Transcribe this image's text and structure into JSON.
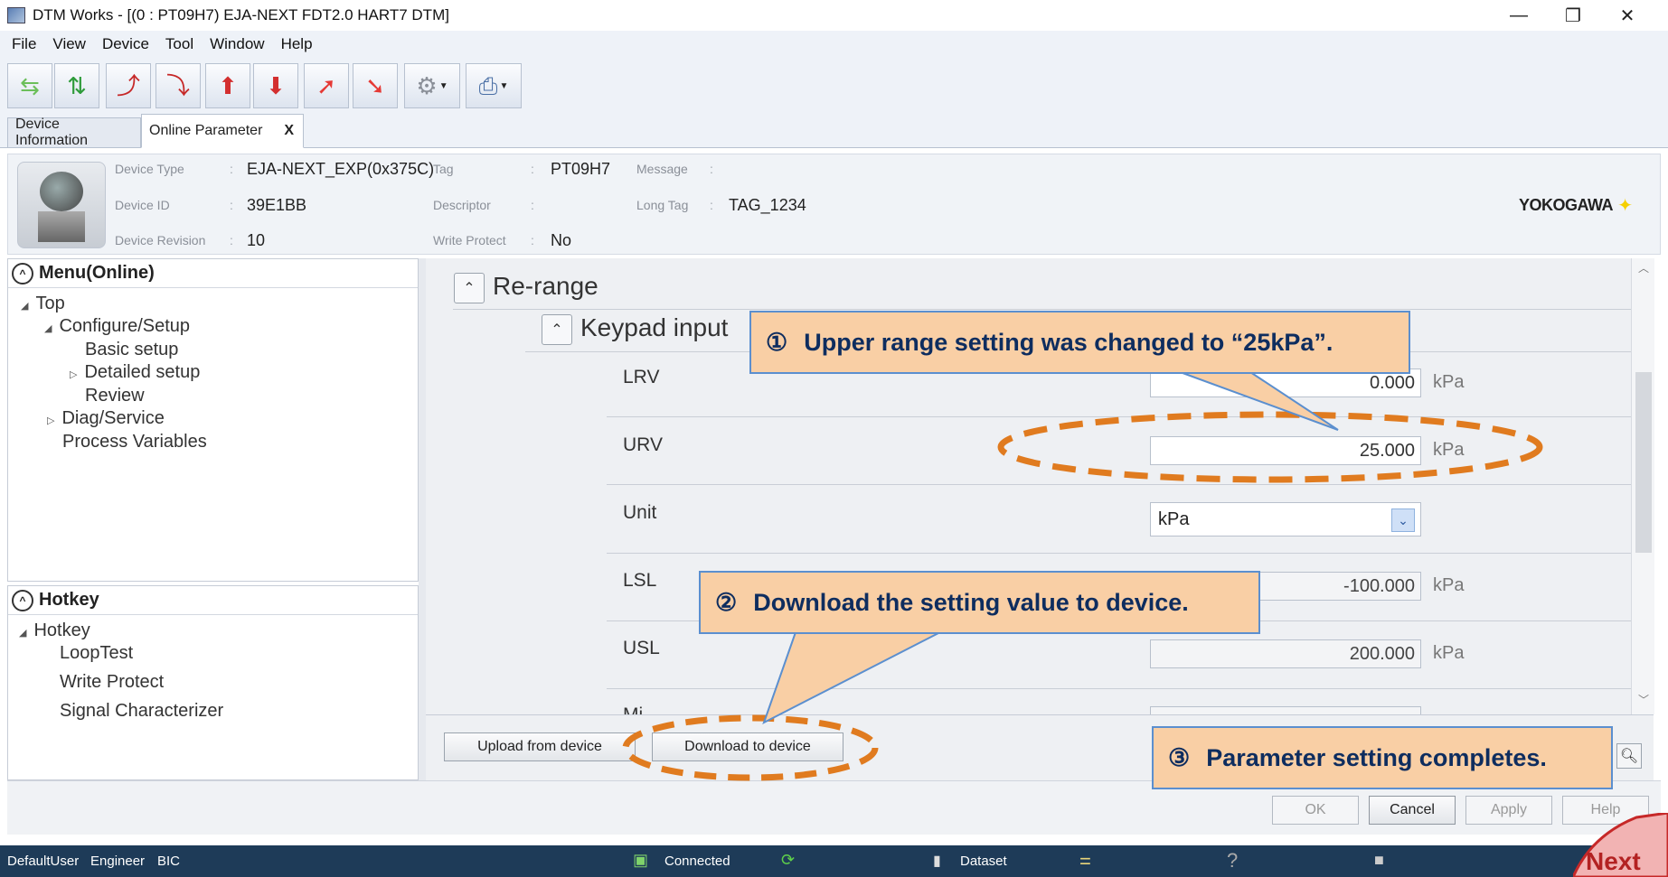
{
  "window": {
    "title": "DTM Works - [(0 : PT09H7) EJA-NEXT FDT2.0 HART7 DTM]",
    "minimize": "—",
    "restore": "❐",
    "close": "✕"
  },
  "menu": [
    "File",
    "View",
    "Device",
    "Tool",
    "Window",
    "Help"
  ],
  "toolbar": {
    "buttons": [
      {
        "name": "disconnect-icon",
        "glyph": "⇆",
        "color": "#6bbf5a"
      },
      {
        "name": "connect-icon",
        "glyph": "⇅",
        "color": "#2e9b3a"
      },
      {
        "name": "upload-device-icon",
        "glyph": "⤴",
        "color": "#c62828"
      },
      {
        "name": "download-device-icon",
        "glyph": "⤵",
        "color": "#c62828"
      },
      {
        "name": "upload-disk-icon",
        "glyph": "⬆",
        "color": "#d32f2f"
      },
      {
        "name": "download-disk-icon",
        "glyph": "⬇",
        "color": "#d32f2f"
      },
      {
        "name": "export-icon",
        "glyph": "➚",
        "color": "#e53935"
      },
      {
        "name": "import-icon",
        "glyph": "➘",
        "color": "#e53935"
      },
      {
        "name": "settings-tool-icon",
        "glyph": "⚙",
        "color": "#8a8f98",
        "dropdown": true
      },
      {
        "name": "print-icon",
        "glyph": "⎙",
        "color": "#4a6fa5",
        "dropdown": true
      }
    ]
  },
  "tabs": {
    "device_information": "Device Information",
    "online_parameter": "Online Parameter",
    "close": "X"
  },
  "device": {
    "type_label": "Device Type",
    "type_value": "EJA-NEXT_EXP(0x375C)",
    "id_label": "Device ID",
    "id_value": "39E1BB",
    "revision_label": "Device Revision",
    "revision_value": "10",
    "tag_label": "Tag",
    "tag_value": "PT09H7",
    "descriptor_label": "Descriptor",
    "descriptor_value": "",
    "write_protect_label": "Write Protect",
    "write_protect_value": "No",
    "message_label": "Message",
    "message_value": "",
    "long_tag_label": "Long Tag",
    "long_tag_value": "TAG_1234",
    "separator": ":",
    "logo": "YOKOGAWA"
  },
  "menu_panel": {
    "title": "Menu(Online)",
    "items": {
      "top": "Top",
      "configure": "Configure/Setup",
      "basic": "Basic setup",
      "detailed": "Detailed setup",
      "review": "Review",
      "diag": "Diag/Service",
      "process": "Process Variables"
    }
  },
  "hotkey_panel": {
    "title": "Hotkey",
    "items": {
      "root": "Hotkey",
      "loop": "LoopTest",
      "write_protect": "Write Protect",
      "signal": "Signal Characterizer"
    }
  },
  "params": {
    "rerange": "Re-range",
    "keypad": "Keypad input",
    "lrv_label": "LRV",
    "lrv_value": "0.000",
    "urv_label": "URV",
    "urv_value": "25.000",
    "unit_label": "Unit",
    "unit_value": "kPa",
    "lsl_label": "LSL",
    "lsl_value": "-100.000",
    "usl_label": "USL",
    "usl_value": "200.000",
    "unit": "kPa",
    "partial_label": "Mi"
  },
  "buttons": {
    "upload": "Upload from device",
    "download": "Download to device",
    "ok": "OK",
    "cancel": "Cancel",
    "apply": "Apply",
    "help": "Help"
  },
  "status": {
    "user": "DefaultUser",
    "role": "Engineer",
    "bic": "BIC",
    "connected": "Connected",
    "dataset": "Dataset",
    "compare": "=",
    "unknown": "?"
  },
  "callouts": {
    "c1_num": "①",
    "c1_text": "Upper range setting  was changed to “25kPa”.",
    "c2_num": "②",
    "c2_text": "Download the setting value to device.",
    "c3_num": "③",
    "c3_text": "Parameter setting  completes."
  },
  "next": "Next",
  "colors": {
    "callout_bg": "#f9cfa5",
    "callout_border": "#5b8fcf",
    "highlight_ellipse": "#e07b1f",
    "statusbar": "#1e3b58"
  }
}
